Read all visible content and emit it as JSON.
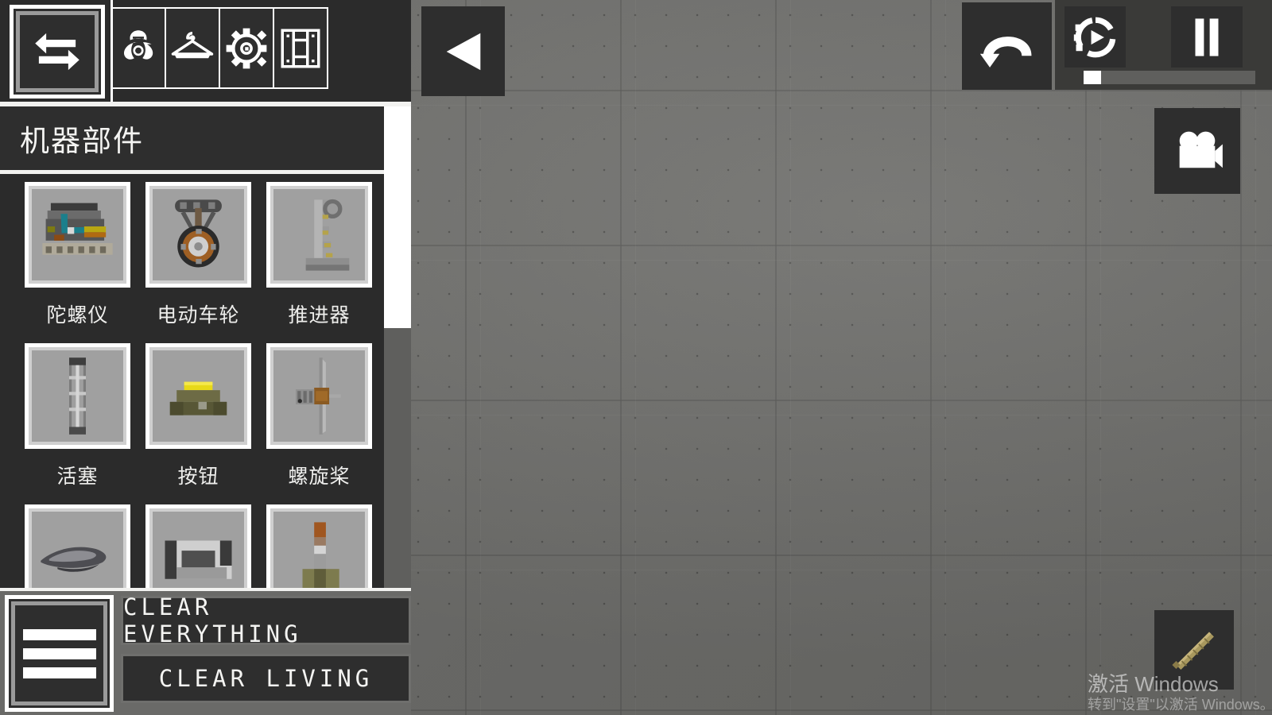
{
  "app": {
    "background_color": "#737370",
    "panel_color": "#2e2e2e",
    "accent_color": "#ffffff"
  },
  "left_panel": {
    "tabs": [
      {
        "icon": "swap-arrows-icon",
        "name": "tab-transform",
        "selected": true
      },
      {
        "icon": "biohazard-icon",
        "name": "tab-biohazard",
        "selected": false
      },
      {
        "icon": "clothes-hanger-icon",
        "name": "tab-clothing",
        "selected": false
      },
      {
        "icon": "gear-cog-icon",
        "name": "tab-machine-parts",
        "selected": false
      },
      {
        "icon": "furniture-panel-icon",
        "name": "tab-structures",
        "selected": false
      }
    ],
    "category": {
      "title": "机器部件"
    },
    "items": [
      {
        "label": "陀螺仪",
        "art": "gyroscope"
      },
      {
        "label": "电动车轮",
        "art": "motor-wheel"
      },
      {
        "label": "推进器",
        "art": "thruster"
      },
      {
        "label": "活塞",
        "art": "piston"
      },
      {
        "label": "按钮",
        "art": "button-block"
      },
      {
        "label": "螺旋桨",
        "art": "propeller"
      },
      {
        "label": "",
        "art": "blade"
      },
      {
        "label": "",
        "art": "roller"
      },
      {
        "label": "",
        "art": "rod-stand"
      }
    ],
    "scrollbar": {
      "thumb_top_pct": 0,
      "thumb_height_pct": 46
    },
    "bottom": {
      "menu_icon": "hamburger-menu-icon",
      "clear_everything_label": "CLEAR EVERYTHING",
      "clear_living_label": "CLEAR LIVING"
    }
  },
  "canvas_controls": {
    "collapse_panel_icon": "triangle-left-icon",
    "undo_icon": "undo-arrow-icon",
    "speed_icon": "play-speed-icon",
    "pause_icon": "pause-icon",
    "camera_icon": "video-camera-icon",
    "speed_slider_value_pct": 0,
    "hotbar_item_icon": "wooden-rod-item"
  },
  "watermark": {
    "line1": "激活 Windows",
    "line2": "转到\"设置\"以激活 Windows。"
  }
}
